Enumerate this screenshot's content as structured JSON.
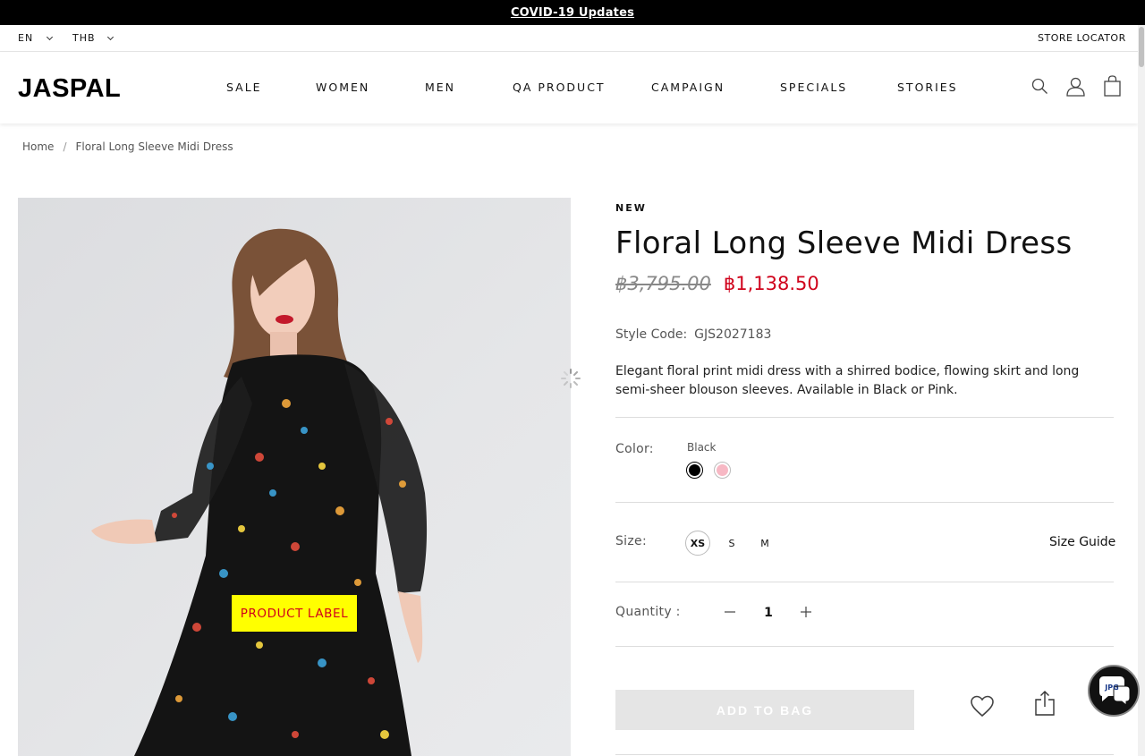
{
  "topbar": {
    "link": "COVID-19 Updates"
  },
  "utility": {
    "language": "EN",
    "currency": "THB",
    "store_locator": "STORE LOCATOR"
  },
  "header": {
    "logo": "JASPAL",
    "nav": [
      "SALE",
      "WOMEN",
      "MEN",
      "QA PRODUCT",
      "CAMPAIGN",
      "SPECIALS",
      "STORIES"
    ],
    "icons": [
      "search-icon",
      "account-icon",
      "bag-icon"
    ]
  },
  "breadcrumb": {
    "home": "Home",
    "separator": "/",
    "current": "Floral Long Sleeve Midi Dress"
  },
  "product": {
    "badge": "NEW",
    "title": "Floral Long Sleeve Midi Dress",
    "old_price": "฿3,795.00",
    "price": "฿1,138.50",
    "style_code_label": "Style Code:",
    "style_code": "GJS2027183",
    "description": "Elegant floral print midi dress with a shirred bodice, flowing skirt and long semi-sheer blouson sleeves. Available in Black or Pink.",
    "image_label": "PRODUCT LABEL"
  },
  "options": {
    "color_label": "Color:",
    "selected_color": "Black",
    "colors": [
      {
        "name": "Black",
        "hex": "#000000"
      },
      {
        "name": "Pink",
        "hex": "#f7b8c4"
      }
    ],
    "size_label": "Size:",
    "sizes": [
      "XS",
      "S",
      "M"
    ],
    "selected_size": "XS",
    "size_guide": "Size Guide",
    "quantity_label": "Quantity :",
    "quantity": "1"
  },
  "actions": {
    "add_to_bag": "ADD TO BAG",
    "chat_badge": "JPG"
  },
  "colors": {
    "sale_red": "#d0021b",
    "label_yellow": "#ffff00",
    "topbar": "#000000"
  }
}
